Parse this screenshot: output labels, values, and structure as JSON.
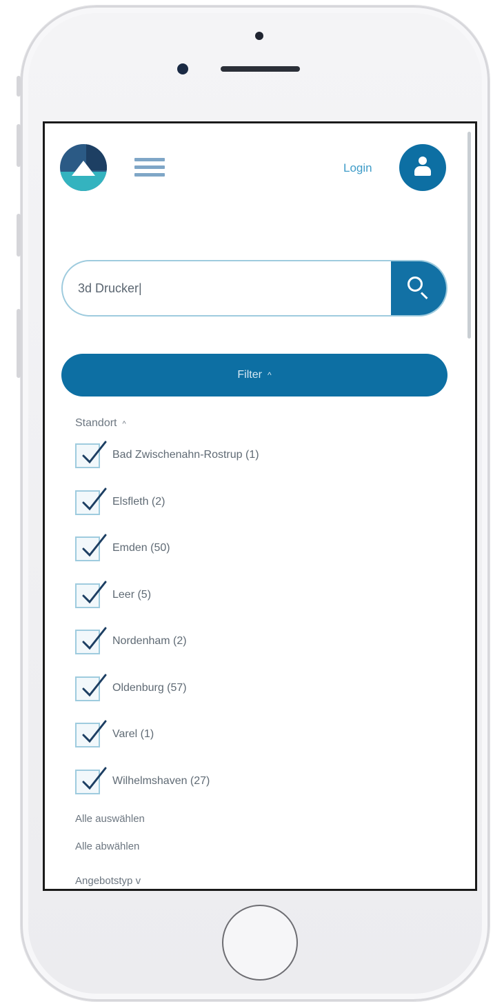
{
  "header": {
    "login_label": "Login"
  },
  "search": {
    "value": "3d Drucker|"
  },
  "filter": {
    "label": "Filter",
    "chevron": "^"
  },
  "standort": {
    "label": "Standort",
    "chevron": "^",
    "options": [
      {
        "label": "Bad Zwischenahn-Rostrup (1)",
        "checked": true
      },
      {
        "label": "Elsfleth (2)",
        "checked": true
      },
      {
        "label": "Emden (50)",
        "checked": true
      },
      {
        "label": "Leer (5)",
        "checked": true
      },
      {
        "label": "Nordenham (2)",
        "checked": true
      },
      {
        "label": "Oldenburg (57)",
        "checked": true
      },
      {
        "label": "Varel (1)",
        "checked": true
      },
      {
        "label": "Wilhelmshaven (27)",
        "checked": true
      }
    ],
    "select_all": "Alle auswählen",
    "deselect_all": "Alle abwählen"
  },
  "next_section": {
    "label": "Angebotstyp",
    "chevron": "v"
  },
  "colors": {
    "primary": "#0d6fa3",
    "accent": "#34b3bf",
    "checkbox_border": "#9ecbde",
    "checkmark": "#1d3f63"
  },
  "icons": [
    "logo",
    "hamburger-menu-icon",
    "user-icon",
    "search-icon",
    "checkmark-icon",
    "chevron-up-icon",
    "chevron-down-icon"
  ]
}
